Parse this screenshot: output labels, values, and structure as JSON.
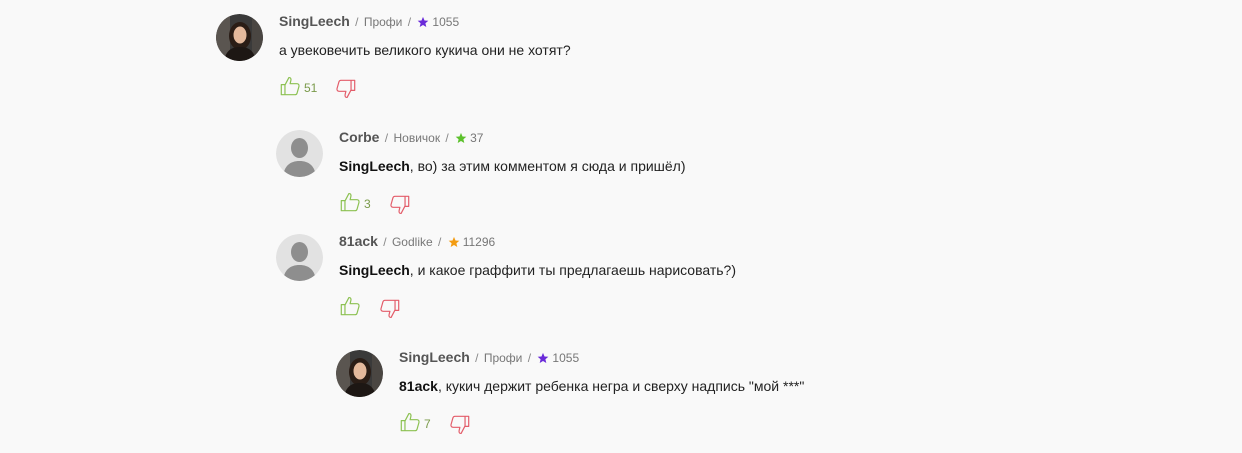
{
  "colors": {
    "like": "#8cc152",
    "dislike": "#e35d6a",
    "star_purple": "#6a2bd9",
    "star_green": "#5cc12c",
    "star_orange": "#f39c12"
  },
  "comments": [
    {
      "author": "SingLeech",
      "rank": "Профи",
      "rating": "1055",
      "star_color": "purple",
      "mention": "",
      "text": "а увековечить великого кукича они не хотят?",
      "likes": "51",
      "avatar": "photo"
    },
    {
      "author": "Corbe",
      "rank": "Новичок",
      "rating": "37",
      "star_color": "green",
      "mention": "SingLeech",
      "text": ", во) за этим комментом я сюда и пришёл)",
      "likes": "3",
      "avatar": "default"
    },
    {
      "author": "81ack",
      "rank": "Godlike",
      "rating": "11296",
      "star_color": "orange",
      "mention": "SingLeech",
      "text": ", и какое граффити ты предлагаешь нарисовать?)",
      "likes": "",
      "avatar": "default"
    },
    {
      "author": "SingLeech",
      "rank": "Профи",
      "rating": "1055",
      "star_color": "purple",
      "mention": "81ack",
      "text": ", кукич держит ребенка негра и сверху надпись \"мой ***\"",
      "likes": "7",
      "avatar": "photo"
    }
  ]
}
